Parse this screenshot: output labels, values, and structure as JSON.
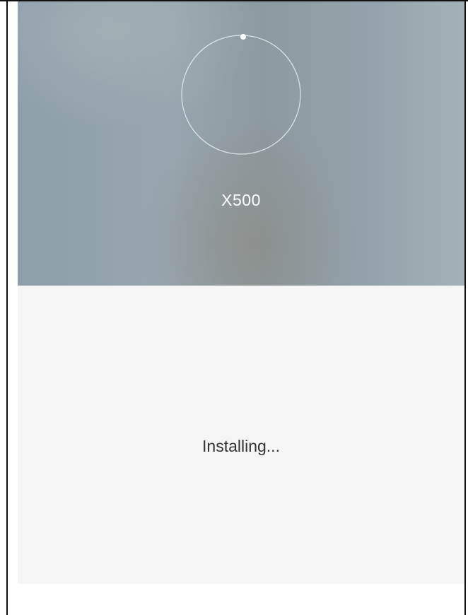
{
  "device": {
    "name": "X500"
  },
  "install": {
    "status_text": "Installing..."
  },
  "colors": {
    "panel_background": "#f5f5f5",
    "ring_stroke": "#e6ecef",
    "indicator_dot": "#ffffff"
  },
  "icons": {
    "progress": "progress-ring-icon"
  }
}
